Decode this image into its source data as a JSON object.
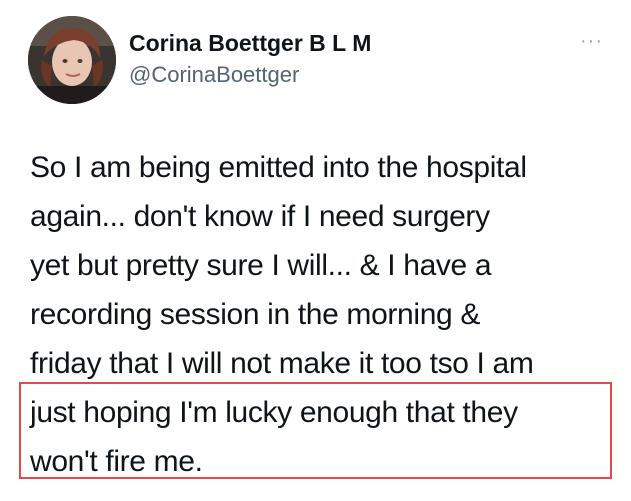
{
  "tweet": {
    "author": {
      "display_name": "Corina Boettger B L M",
      "handle": "@CorinaBoettger"
    },
    "more_label": "···",
    "body_lines": [
      "So I am being emitted into the hospital",
      "again... don't know if I need surgery",
      "yet but pretty sure I will... & I have a",
      "recording session in the morning &",
      "friday that I will not make it too tso I am",
      "just hoping I'm lucky enough that they",
      "won't fire me."
    ]
  },
  "highlight": {
    "color": "#e14a4a"
  }
}
